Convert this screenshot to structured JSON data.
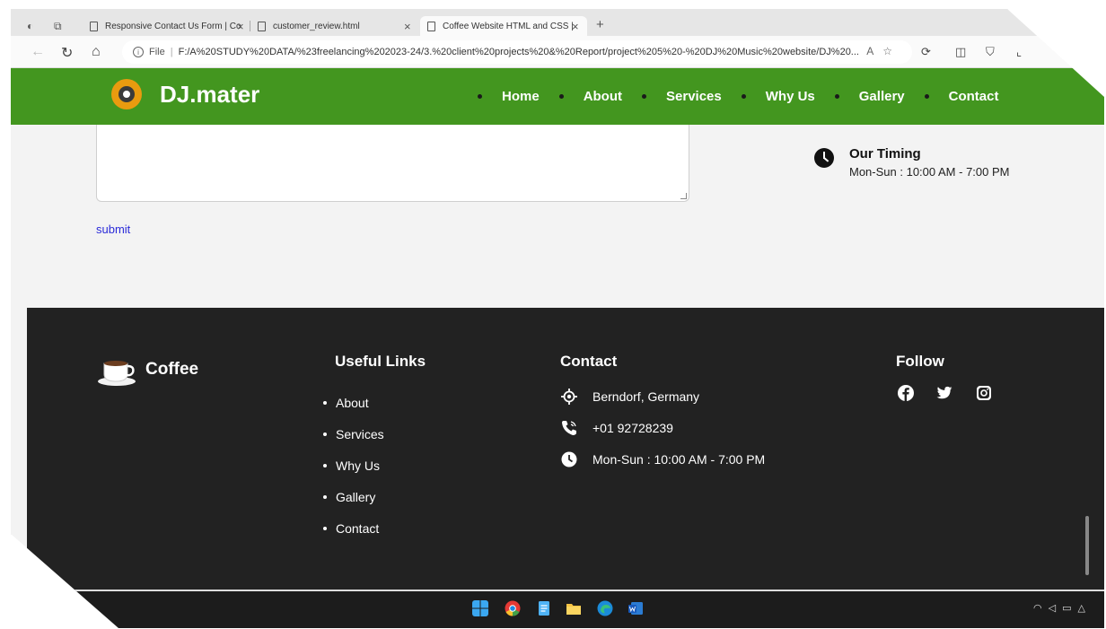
{
  "browser": {
    "tabs": [
      {
        "label": "Responsive Contact Us Form | Co"
      },
      {
        "label": "customer_review.html"
      },
      {
        "label": "Coffee Website HTML and CSS |"
      }
    ],
    "new_tab": "+",
    "close_glyph": "×",
    "address": {
      "scheme_label": "File",
      "url": "F:/A%20STUDY%20DATA/%23freelancing%202023-24/3.%20client%20projects%20&%20Report/project%205%20-%20DJ%20Music%20website/DJ%20..."
    }
  },
  "header": {
    "brand": "DJ.mater",
    "nav": [
      {
        "label": "Home"
      },
      {
        "label": "About"
      },
      {
        "label": "Services"
      },
      {
        "label": "Why Us"
      },
      {
        "label": "Gallery"
      },
      {
        "label": "Contact"
      }
    ],
    "colors": {
      "bar": "#43961f",
      "logo": "#e99b0f"
    }
  },
  "form": {
    "submit_label": "submit"
  },
  "timing": {
    "title": "Our Timing",
    "text": "Mon-Sun : 10:00 AM - 7:00 PM"
  },
  "footer": {
    "brand": "Coffee",
    "useful_links": {
      "title": "Useful Links",
      "items": [
        "About",
        "Services",
        "Why Us",
        "Gallery",
        "Contact"
      ]
    },
    "contact": {
      "title": "Contact",
      "items": [
        {
          "icon": "location-icon",
          "text": "Berndorf, Germany"
        },
        {
          "icon": "phone-icon",
          "text": "+01 92728239"
        },
        {
          "icon": "clock-icon",
          "text": "Mon-Sun : 10:00 AM - 7:00 PM"
        }
      ]
    },
    "follow": {
      "title": "Follow",
      "icons": [
        "facebook-icon",
        "twitter-icon",
        "instagram-icon"
      ]
    }
  },
  "taskbar": {
    "apps": [
      "windows-start-icon",
      "chrome-icon",
      "notepad-icon",
      "file-explorer-icon",
      "edge-icon",
      "word-icon"
    ]
  }
}
